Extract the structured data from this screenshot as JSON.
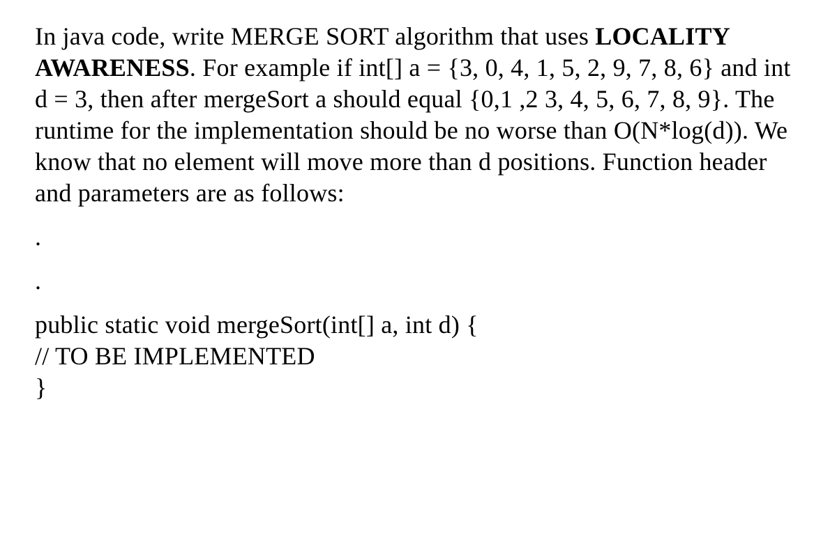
{
  "problem": {
    "line1_part1": "In java code, write MERGE SORT algorithm that uses ",
    "line1_bold": "LOCALITY AWARENESS",
    "line1_part2": ". For example if int[] a = {3, 0, 4, 1, 5, 2, 9, 7, 8, 6} and int d = 3, then after mergeSort a should equal {0,1 ,2 3, 4, 5, 6, 7, 8, 9}. The runtime for the implementation should be no worse than O(N*log(d)). We know that no element will move more than d positions. Function header and parameters are as follows:"
  },
  "bullets": {
    "b1": ".",
    "b2": "."
  },
  "code": {
    "line1": "public static void mergeSort(int[] a, int d) {",
    "line2": "// TO BE IMPLEMENTED",
    "line3": "}"
  }
}
